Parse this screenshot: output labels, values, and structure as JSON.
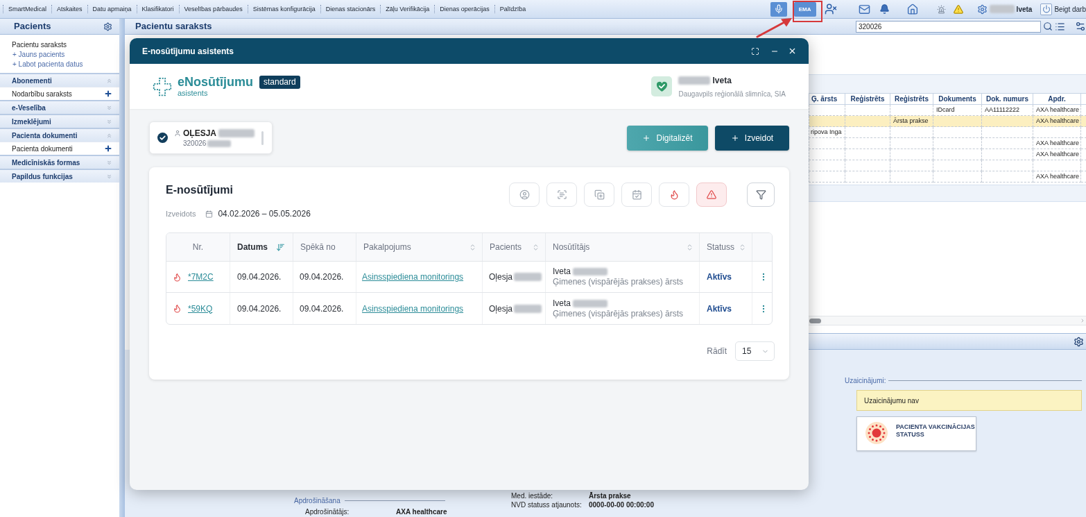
{
  "menu_bar": {
    "items": [
      "SmartMedical",
      "Atskaites",
      "Datu apmaiņa",
      "Klasifikatori",
      "Veselības pārbaudes",
      "Sistēmas konfigurācija",
      "Dienas stacionārs",
      "Zāļu Verifikācija",
      "Dienas operācijas",
      "Palīdzība"
    ],
    "tools": [
      {
        "kind": "voice"
      },
      {
        "kind": "ema",
        "label": "EMA"
      },
      {
        "kind": "user-blocked"
      },
      {
        "kind": "mail"
      },
      {
        "kind": "bell"
      },
      {
        "kind": "home"
      },
      {
        "kind": "alarm"
      },
      {
        "kind": "warning"
      },
      {
        "kind": "gear"
      }
    ],
    "user": "Iveta",
    "logout": "Beigt darb"
  },
  "left_panel": {
    "title": "Pacients",
    "links": [
      {
        "label": "Pacientu saraksts",
        "kind": "page"
      },
      {
        "label": "+ Jauns pacients",
        "kind": "action"
      },
      {
        "label": "+ Labot pacienta datus",
        "kind": "action"
      }
    ],
    "sections": [
      {
        "title": "Abonementi",
        "expanded": true,
        "items": [
          "Nodarbību saraksts"
        ]
      },
      {
        "title": "e-Veselība",
        "expanded": false
      },
      {
        "title": "Izmeklējumi",
        "expanded": false
      },
      {
        "title": "Pacienta dokumenti",
        "expanded": true,
        "items": [
          "Pacienta dokumenti"
        ]
      },
      {
        "title": "Medicīniskās formas",
        "expanded": false
      },
      {
        "title": "Papildus funkcijas",
        "expanded": false
      }
    ]
  },
  "main": {
    "title": "Pacientu saraksts",
    "search": {
      "value": "320026"
    },
    "table": {
      "columns": [
        "Ģ. ārsts",
        "Reģistrēts",
        "Reģistrēts",
        "Dokuments",
        "Dok. numurs",
        "Apdr."
      ],
      "rows": [
        {
          "selected": false,
          "cells": [
            null,
            null,
            null,
            "IDcard",
            "AA11112222",
            "AXA healthcare"
          ]
        },
        {
          "selected": true,
          "cells": [
            null,
            null,
            "Ārsta prakse",
            null,
            null,
            "AXA healthcare"
          ]
        },
        {
          "selected": false,
          "cells": [
            "ripova Inga",
            null,
            null,
            null,
            null,
            null
          ]
        },
        {
          "selected": false,
          "cells": [
            null,
            null,
            null,
            null,
            null,
            "AXA healthcare"
          ]
        },
        {
          "selected": false,
          "cells": [
            null,
            null,
            null,
            null,
            null,
            "AXA healthcare"
          ]
        },
        {
          "selected": false,
          "cells": [
            null,
            null,
            null,
            null,
            null,
            null
          ]
        },
        {
          "selected": false,
          "cells": [
            null,
            null,
            null,
            null,
            null,
            "AXA healthcare"
          ]
        }
      ]
    },
    "invitations": {
      "legend": "Uzaicinājumi:",
      "message": "Uzaicinājumu nav"
    },
    "vaccination_card": {
      "title": "PACIENTA VAKCINĀCIJAS STATUSS"
    },
    "insurance": {
      "legend": "Apdrošināšana",
      "label": "Apdrošinātājs:",
      "value": "AXA healthcare"
    },
    "details": [
      {
        "label": "Med. iestāde:",
        "value": "Ārsta prakse"
      },
      {
        "label": "NVD statuss atjaunots:",
        "value": "0000-00-00 00:00:00"
      }
    ]
  },
  "modal": {
    "title": "E-nosūtījumu asistents",
    "brand": {
      "name": "eNosūtījumu",
      "badge": "standard",
      "subtitle": "asistents"
    },
    "user": {
      "name": "Iveta",
      "organization": "Daugavpils reģionālā slimnīca, SIA"
    },
    "patient": {
      "name": "OĻESJA",
      "code": "320026",
      "selected": true
    },
    "actions": [
      {
        "label": "Digitalizēt",
        "kind": "secondary"
      },
      {
        "label": "Izveidot",
        "kind": "primary"
      }
    ],
    "referrals": {
      "title": "E-nosūtījumi",
      "created_label": "Izveidots",
      "date_range": "04.02.2026 – 05.05.2026",
      "filters": [
        {
          "kind": "person"
        },
        {
          "kind": "scan"
        },
        {
          "kind": "copy"
        },
        {
          "kind": "calendar"
        },
        {
          "kind": "urgent"
        },
        {
          "kind": "warning"
        }
      ],
      "columns": [
        {
          "label": "Nr.",
          "kind": "plain"
        },
        {
          "label": "Datums",
          "kind": "sorted"
        },
        {
          "label": "Spēkā no",
          "kind": "plain"
        },
        {
          "label": "Pakalpojums",
          "kind": "sortable"
        },
        {
          "label": "Pacients",
          "kind": "sortable"
        },
        {
          "label": "Nosūtītājs",
          "kind": "sortable"
        },
        {
          "label": "Statuss",
          "kind": "sortable"
        }
      ],
      "rows": [
        {
          "urgent": true,
          "number": "*7M2C",
          "date": "09.04.2026.",
          "valid_from": "09.04.2026.",
          "service": "Asinsspiediena monitorings",
          "patient": "Oļesja",
          "sender": "Iveta",
          "sender_role": "Ģimenes (vispārējās prakses) ārsts",
          "status": "Aktīvs"
        },
        {
          "urgent": true,
          "number": "*59KQ",
          "date": "09.04.2026.",
          "valid_from": "09.04.2026.",
          "service": "Asinsspiediena monitorings",
          "patient": "Oļesja",
          "sender": "Iveta",
          "sender_role": "Ģimenes (vispārējās prakses) ārsts",
          "status": "Aktīvs"
        }
      ],
      "page_size_label": "Rādīt",
      "page_size": "15"
    }
  }
}
